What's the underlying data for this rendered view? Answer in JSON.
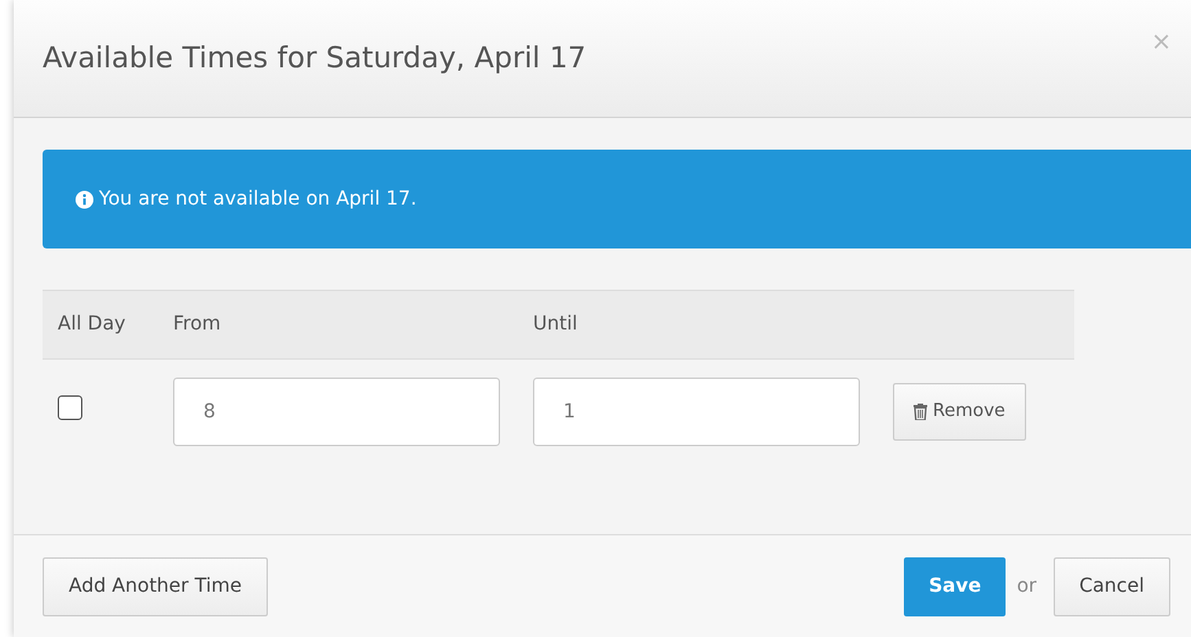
{
  "dialog": {
    "title": "Available Times for Saturday, April 17",
    "close": "×"
  },
  "alert": {
    "message": "You are not available on April 17."
  },
  "table": {
    "columns": [
      "All Day",
      "From",
      "Until"
    ],
    "rows": [
      {
        "all_day": false,
        "from": "8",
        "until": "1",
        "remove": "Remove"
      }
    ]
  },
  "footer": {
    "add": "Add Another Time",
    "save": "Save",
    "or": "or",
    "cancel": "Cancel"
  }
}
